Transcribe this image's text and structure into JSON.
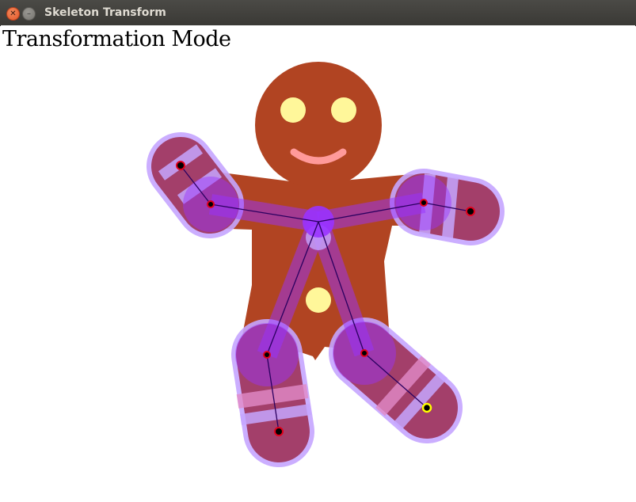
{
  "window": {
    "title": "Skeleton Transform",
    "close_glyph": "✕",
    "minimize_glyph": "–"
  },
  "canvas": {
    "mode_label": "Transformation Mode"
  },
  "colors": {
    "body": "#b14422",
    "eye": "#fff79a",
    "mouth": "#ff9a9a",
    "button": "#fff79a",
    "limb_highlight": "#9933ff",
    "joint": "#000000",
    "joint_ring": "#e0001b",
    "selected_joint_ring": "#ffff00",
    "bone_line": "#2a0060"
  },
  "icons": [
    "close-icon",
    "minimize-icon"
  ]
}
